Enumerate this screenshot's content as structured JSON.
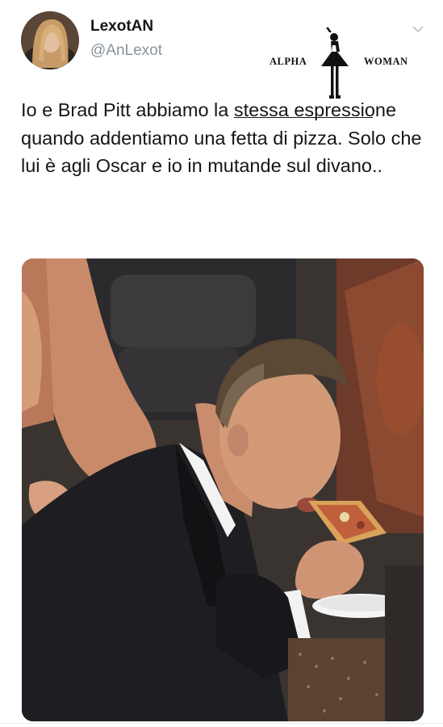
{
  "tweet": {
    "display_name": "LexotAN",
    "handle": "@AnLexot",
    "text_line1_pre": "Io e Brad Pitt abbiamo la ",
    "text_line1_ul": "stessa",
    "text_rest": "espressione quando addentiamo una fetta di pizza. Solo che lui è agli Oscar e io in mutande sul divano..",
    "avatar_icon": "profile-photo",
    "menu_icon": "chevron-down-icon",
    "photo_icon": "photo-man-eating-pizza"
  },
  "watermark": {
    "left": "ALPHA",
    "right": "WOMAN"
  },
  "colors": {
    "text": "#14171a",
    "muted": "#8a949d",
    "background": "#ffffff"
  }
}
